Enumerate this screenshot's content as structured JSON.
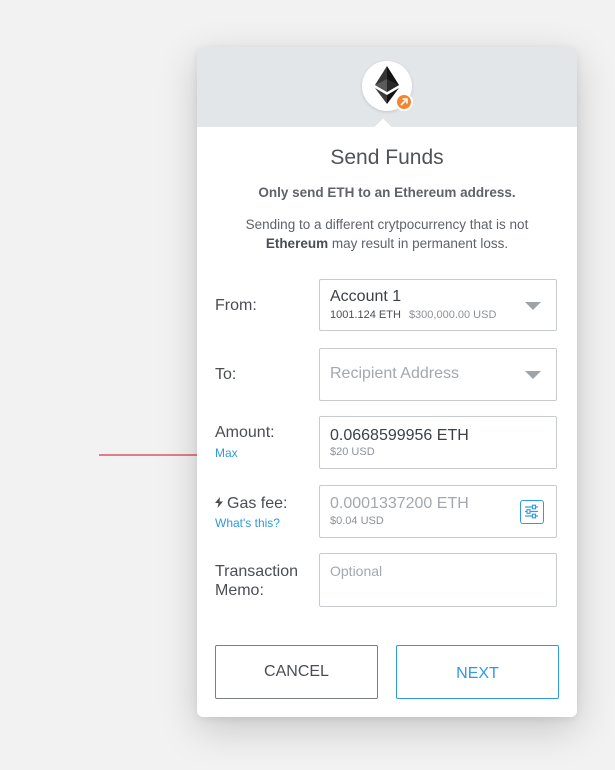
{
  "header": {
    "token_icon": "ethereum-icon",
    "badge_icon": "send-arrow-icon",
    "badge_color": "#f5862e",
    "header_bg": "#e3e6e9"
  },
  "title": "Send Funds",
  "subtitle": "Only send ETH to an Ethereum address.",
  "warning": {
    "prefix": "Sending to a different crytpocurrency that is not",
    "emphasis": "Ethereum",
    "suffix": "may result in permanent loss."
  },
  "from": {
    "label": "From:",
    "account_name": "Account 1",
    "balance_eth": "1001.124 ETH",
    "balance_usd": "$300,000.00 USD"
  },
  "to": {
    "label": "To:",
    "placeholder": "Recipient Address"
  },
  "amount": {
    "label": "Amount:",
    "max_link": "Max",
    "value_eth": "0.0668599956 ETH",
    "value_usd": "$20 USD"
  },
  "gas": {
    "label": "Gas fee:",
    "help_link": "What's this?",
    "value_eth": "0.0001337200 ETH",
    "value_usd": "$0.04 USD",
    "settings_icon": "sliders-icon"
  },
  "memo": {
    "label_line1": "Transaction",
    "label_line2": "Memo:",
    "placeholder": "Optional"
  },
  "buttons": {
    "cancel": "CANCEL",
    "next": "NEXT"
  },
  "accent_color": "#2f9ae0",
  "annotation_color": "#d33a4a"
}
